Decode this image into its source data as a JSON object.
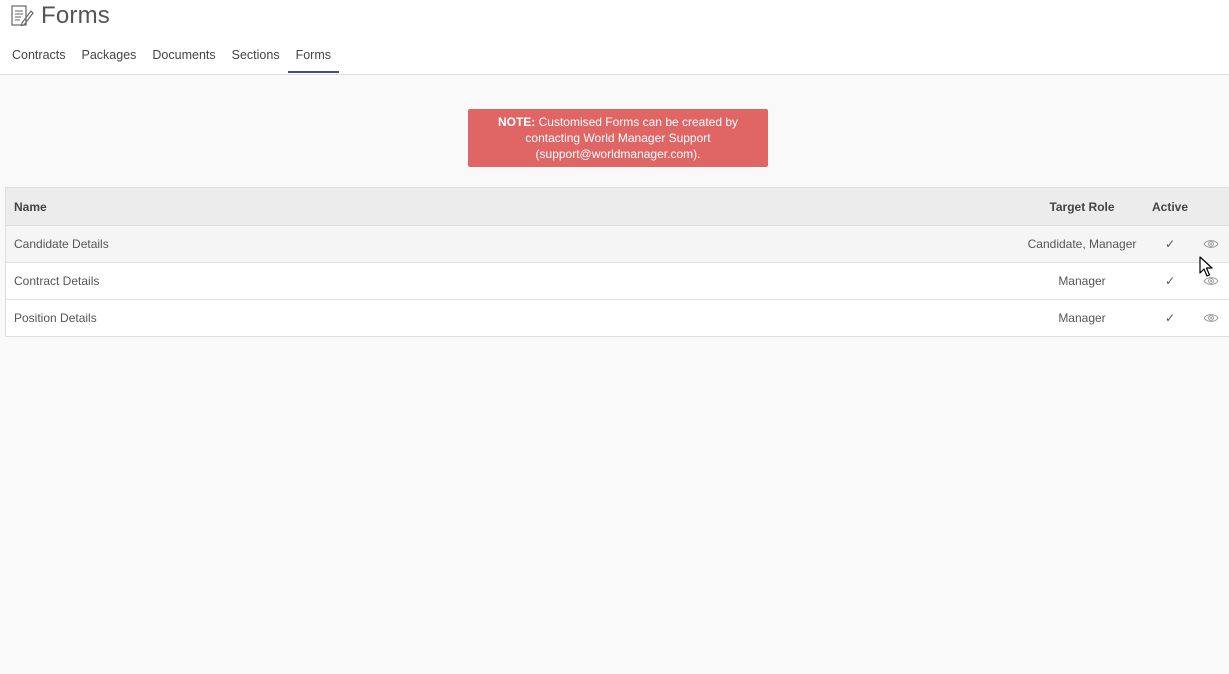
{
  "page": {
    "title": "Forms",
    "title_icon": "form-edit-icon"
  },
  "tabs": [
    {
      "label": "Contracts",
      "active": false
    },
    {
      "label": "Packages",
      "active": false
    },
    {
      "label": "Documents",
      "active": false
    },
    {
      "label": "Sections",
      "active": false
    },
    {
      "label": "Forms",
      "active": true
    }
  ],
  "note": {
    "prefix": "NOTE:",
    "text": " Customised Forms can be created by contacting World Manager Support (support@worldmanager.com)."
  },
  "table": {
    "headers": {
      "name": "Name",
      "target_role": "Target Role",
      "active": "Active"
    },
    "rows": [
      {
        "name": "Candidate Details",
        "target_role": "Candidate, Manager",
        "active": "✓",
        "action_icon": "eye-icon"
      },
      {
        "name": "Contract Details",
        "target_role": "Manager",
        "active": "✓",
        "action_icon": "eye-icon"
      },
      {
        "name": "Position Details",
        "target_role": "Manager",
        "active": "✓",
        "action_icon": "eye-icon"
      }
    ]
  },
  "colors": {
    "note_bg": "#e06666",
    "tab_active_underline": "#3d4f7c",
    "header_bg": "#ebeceb",
    "page_bg": "#f9f9f9"
  }
}
